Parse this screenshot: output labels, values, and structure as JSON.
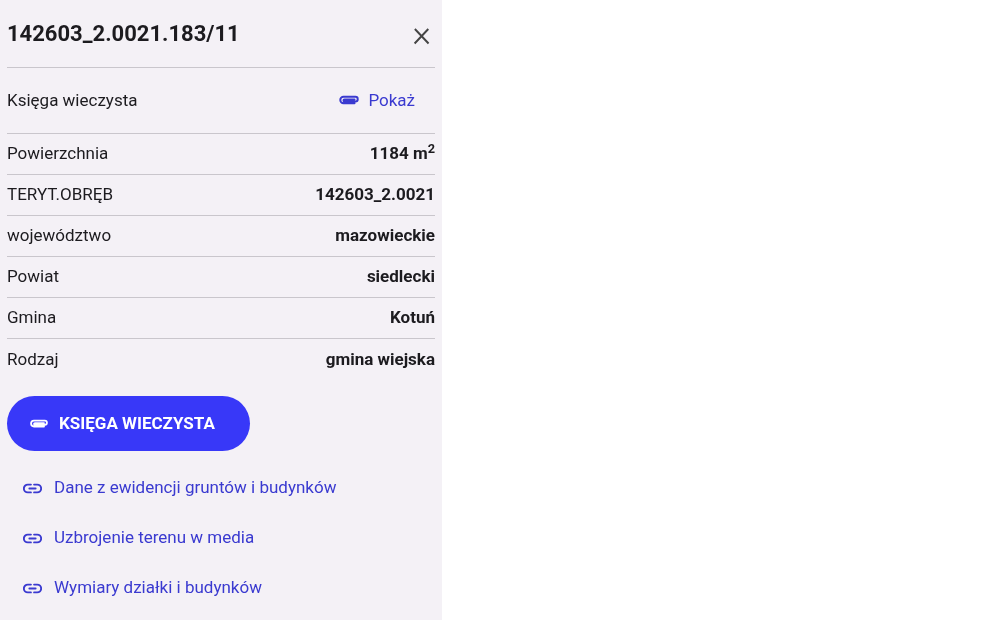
{
  "panel": {
    "title": "142603_2.0021.183/11",
    "close": "×"
  },
  "register_row": {
    "label": "Księga wieczysta",
    "link": "Pokaż"
  },
  "rows": [
    {
      "label": "Powierzchnia",
      "value": "1184 m$^{2}$"
    },
    {
      "label": "TERYT.OBRĘB",
      "value": "142603_2.0021"
    },
    {
      "label": "województwo",
      "value": "mazowieckie"
    },
    {
      "label": "Powiat",
      "value": "siedlecki"
    },
    {
      "label": "Gmina",
      "value": "Kotuń"
    },
    {
      "label": "Rodzaj",
      "value": "gmina wiejska"
    }
  ],
  "primary_button": "KSIĘGA WIECZYSTA",
  "links": [
    "Dane z ewidencji gruntów i budynków",
    "Uzbrojenie terenu w media",
    "Wymiary działki i budynków"
  ]
}
